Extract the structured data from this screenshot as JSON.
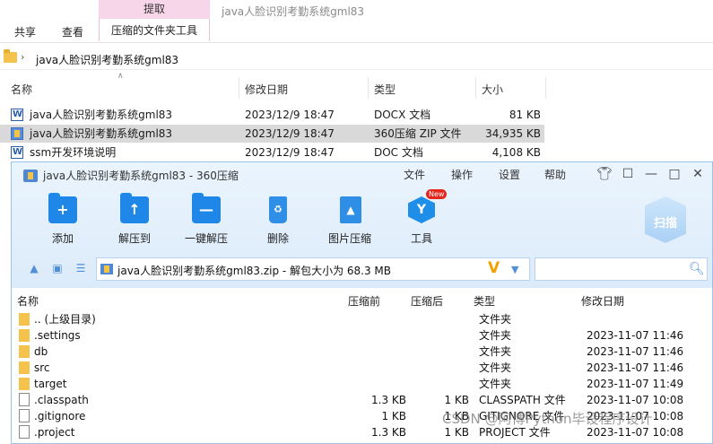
{
  "explorer": {
    "ribbon": {
      "context_header": "提取",
      "window_title": "java人脸识别考勤系统gml83",
      "tabs": [
        "共享",
        "查看"
      ],
      "context_tab": "压缩的文件夹工具"
    },
    "address": "java人脸识别考勤系统gml83",
    "columns": {
      "name": "名称",
      "modified": "修改日期",
      "type": "类型",
      "size": "大小"
    },
    "files": [
      {
        "name": "java人脸识别考勤系统gml83",
        "modified": "2023/12/9 18:47",
        "type": "DOCX 文档",
        "size": "81 KB",
        "icon": "word-docx-icon"
      },
      {
        "name": "java人脸识别考勤系统gml83",
        "modified": "2023/12/9 18:47",
        "type": "360压缩 ZIP 文件",
        "size": "34,935 KB",
        "icon": "zip-archive-icon"
      },
      {
        "name": "ssm开发环境说明",
        "modified": "2023/12/9 18:47",
        "type": "DOC 文档",
        "size": "4,108 KB",
        "icon": "word-doc-icon"
      }
    ]
  },
  "zip": {
    "title": "java人脸识别考勤系统gml83 - 360压缩",
    "menu": [
      "文件",
      "操作",
      "设置",
      "帮助"
    ],
    "toolbar": [
      {
        "label": "添加",
        "icon": "add-folder-icon"
      },
      {
        "label": "解压到",
        "icon": "extract-to-icon"
      },
      {
        "label": "一键解压",
        "icon": "one-click-extract-icon"
      },
      {
        "label": "删除",
        "icon": "recycle-bin-icon"
      },
      {
        "label": "图片压缩",
        "icon": "image-compress-icon"
      },
      {
        "label": "工具",
        "icon": "tools-icon"
      }
    ],
    "new_badge": "New",
    "scan_label": "扫描",
    "path_text": "java人脸识别考勤系统gml83.zip - 解包大小为 68.3 MB",
    "columns": {
      "name": "名称",
      "before": "压缩前",
      "after": "压缩后",
      "type": "类型",
      "modified": "修改日期"
    },
    "rows": [
      {
        "name": ".. (上级目录)",
        "before": "",
        "after": "",
        "type": "文件夹",
        "modified": "",
        "kind": "folder"
      },
      {
        "name": ".settings",
        "before": "",
        "after": "",
        "type": "文件夹",
        "modified": "2023-11-07 11:46",
        "kind": "folder"
      },
      {
        "name": "db",
        "before": "",
        "after": "",
        "type": "文件夹",
        "modified": "2023-11-07 11:46",
        "kind": "folder"
      },
      {
        "name": "src",
        "before": "",
        "after": "",
        "type": "文件夹",
        "modified": "2023-11-07 11:46",
        "kind": "folder"
      },
      {
        "name": "target",
        "before": "",
        "after": "",
        "type": "文件夹",
        "modified": "2023-11-07 11:49",
        "kind": "folder"
      },
      {
        "name": ".classpath",
        "before": "1.3 KB",
        "after": "1 KB",
        "type": "CLASSPATH 文件",
        "modified": "2023-11-07 10:08",
        "kind": "file"
      },
      {
        "name": ".gitignore",
        "before": "1 KB",
        "after": "1 KB",
        "type": "GITIGNORE 文件",
        "modified": "2023-11-07 10:08",
        "kind": "file"
      },
      {
        "name": ".project",
        "before": "1.3 KB",
        "after": "1 KB",
        "type": "PROJECT 文件",
        "modified": "2023-11-07 10:08",
        "kind": "file"
      }
    ]
  },
  "watermark": "CSDN @阿博Python毕设程序设计",
  "colors": {
    "accent_blue": "#2f8ee6",
    "selection": "#d9d9d9",
    "extract_tab": "#f7d6ea",
    "folder_yellow": "#f5c34c"
  }
}
